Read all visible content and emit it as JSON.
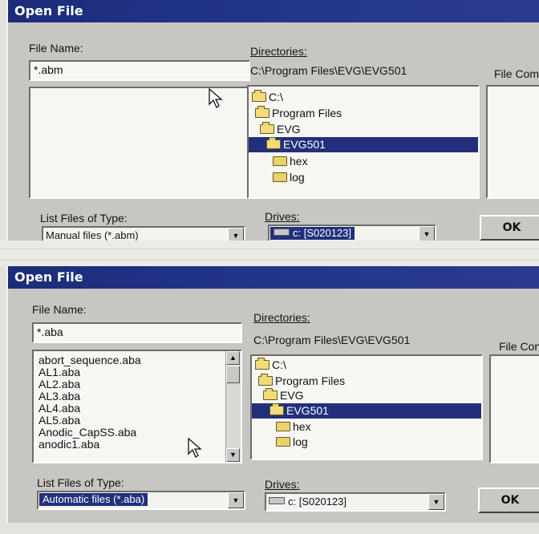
{
  "dialogs": [
    {
      "title": "Open File",
      "file_name_label": "File Name:",
      "file_name_value": "*.abm",
      "files": [],
      "directories_label": "Directories:",
      "directory_path": "C:\\Program Files\\EVG\\EVG501",
      "file_comment_label": "File Com",
      "directory_tree": [
        {
          "label": "C:\\",
          "selected": false
        },
        {
          "label": "Program Files",
          "selected": false
        },
        {
          "label": "EVG",
          "selected": false
        },
        {
          "label": "EVG501",
          "selected": true
        },
        {
          "label": "hex",
          "selected": false
        },
        {
          "label": "log",
          "selected": false
        }
      ],
      "list_type_label": "List Files of Type:",
      "file_type_value": "Manual files (*.abm)",
      "drives_label": "Drives:",
      "drive_value": "c: [S020123]",
      "ok_label": "OK"
    },
    {
      "title": "Open File",
      "file_name_label": "File Name:",
      "file_name_value": "*.aba",
      "files": [
        "abort_sequence.aba",
        "AL1.aba",
        "AL2.aba",
        "AL3.aba",
        "AL4.aba",
        "AL5.aba",
        "Anodic_CapSS.aba",
        "anodic1.aba"
      ],
      "directories_label": "Directories:",
      "directory_path": "C:\\Program Files\\EVG\\EVG501",
      "file_comment_label": "File Con",
      "directory_tree": [
        {
          "label": "C:\\",
          "selected": false
        },
        {
          "label": "Program Files",
          "selected": false
        },
        {
          "label": "EVG",
          "selected": false
        },
        {
          "label": "EVG501",
          "selected": true
        },
        {
          "label": "hex",
          "selected": false
        },
        {
          "label": "log",
          "selected": false
        }
      ],
      "list_type_label": "List Files of Type:",
      "file_type_value": "Automatic files (*.aba)",
      "drives_label": "Drives:",
      "drive_value": "c: [S020123]",
      "ok_label": "OK"
    }
  ],
  "colors": {
    "titlebar": "#1c2c7a",
    "selection": "#22307c",
    "dialog_face": "#c7c6c2"
  }
}
